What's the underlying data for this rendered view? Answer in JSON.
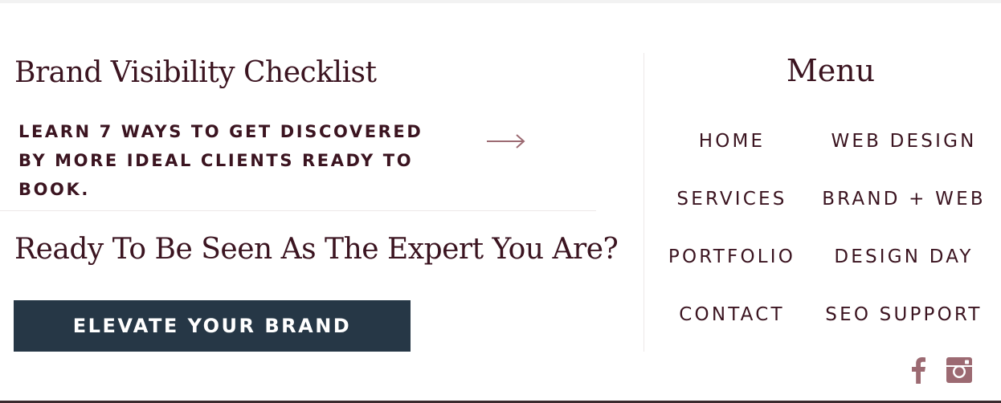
{
  "checklist": {
    "title": "Brand Visibility Checklist",
    "description": "LEARN 7 WAYS TO GET DISCOVERED BY MORE IDEAL CLIENTS READY TO BOOK."
  },
  "cta": {
    "title": "Ready To Be Seen As The Expert You Are?",
    "button_label": "ELEVATE YOUR BRAND"
  },
  "menu": {
    "title": "Menu",
    "items": [
      {
        "label": "HOME"
      },
      {
        "label": "WEB DESIGN"
      },
      {
        "label": "SERVICES"
      },
      {
        "label": "BRAND + WEB"
      },
      {
        "label": "PORTFOLIO"
      },
      {
        "label": "DESIGN DAY"
      },
      {
        "label": "CONTACT"
      },
      {
        "label": "SEO SUPPORT"
      }
    ]
  },
  "social": {
    "icons": [
      "facebook-icon",
      "instagram-icon"
    ]
  },
  "colors": {
    "text": "#3b1420",
    "button": "#263746",
    "icon": "#9c6a72",
    "divider": "#ece8e8"
  }
}
